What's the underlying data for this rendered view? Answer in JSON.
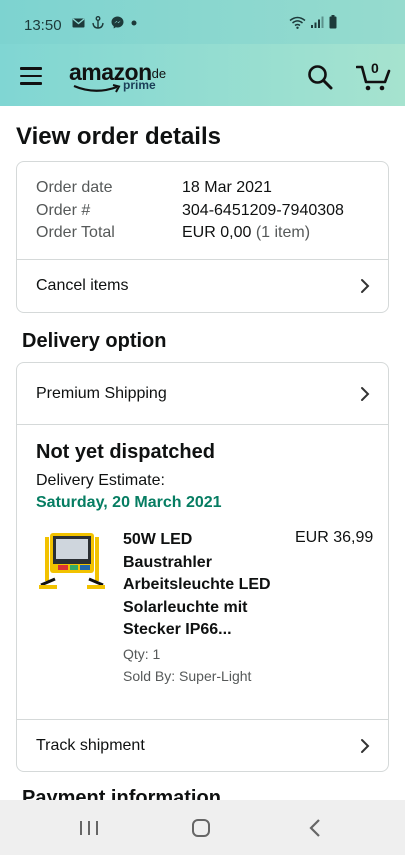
{
  "status_bar": {
    "time": "13:50",
    "icons": [
      "mail-icon",
      "anchor-icon",
      "messenger-icon",
      "dot-icon",
      "wifi-icon",
      "signal-icon",
      "battery-icon"
    ]
  },
  "header": {
    "logo_text": "amazon",
    "logo_tld": ".de",
    "logo_prime": "prime",
    "cart_count": "0",
    "colors": {
      "gradient_start": "#80d6d3",
      "gradient_end": "#a6e3cf"
    }
  },
  "page": {
    "title": "View order details",
    "summary": {
      "order_date_label": "Order date",
      "order_date_value": "18 Mar 2021",
      "order_number_label": "Order #",
      "order_number_value": "304-6451209-7940308",
      "order_total_label": "Order Total",
      "order_total_value": "EUR 0,00",
      "order_total_items": "(1 item)",
      "cancel_label": "Cancel items"
    },
    "delivery": {
      "section_title": "Delivery option",
      "shipping_option": "Premium Shipping",
      "status": "Not yet dispatched",
      "estimate_label": "Delivery Estimate:",
      "estimate_date": "Saturday, 20 March 2021",
      "estimate_color": "#067d62",
      "item": {
        "title_lines": [
          "50W LED",
          "Baustrahler",
          "Arbeitsleuchte LED",
          "Solarleuchte mit",
          "Stecker IP66..."
        ],
        "price": "EUR 36,99",
        "qty": "Qty: 1",
        "sold_by": "Sold By: Super-Light"
      },
      "track_label": "Track shipment"
    },
    "payment_section_title": "Payment information"
  },
  "nav_bar": {
    "buttons": [
      "recent-apps-icon",
      "home-icon",
      "back-icon"
    ]
  }
}
